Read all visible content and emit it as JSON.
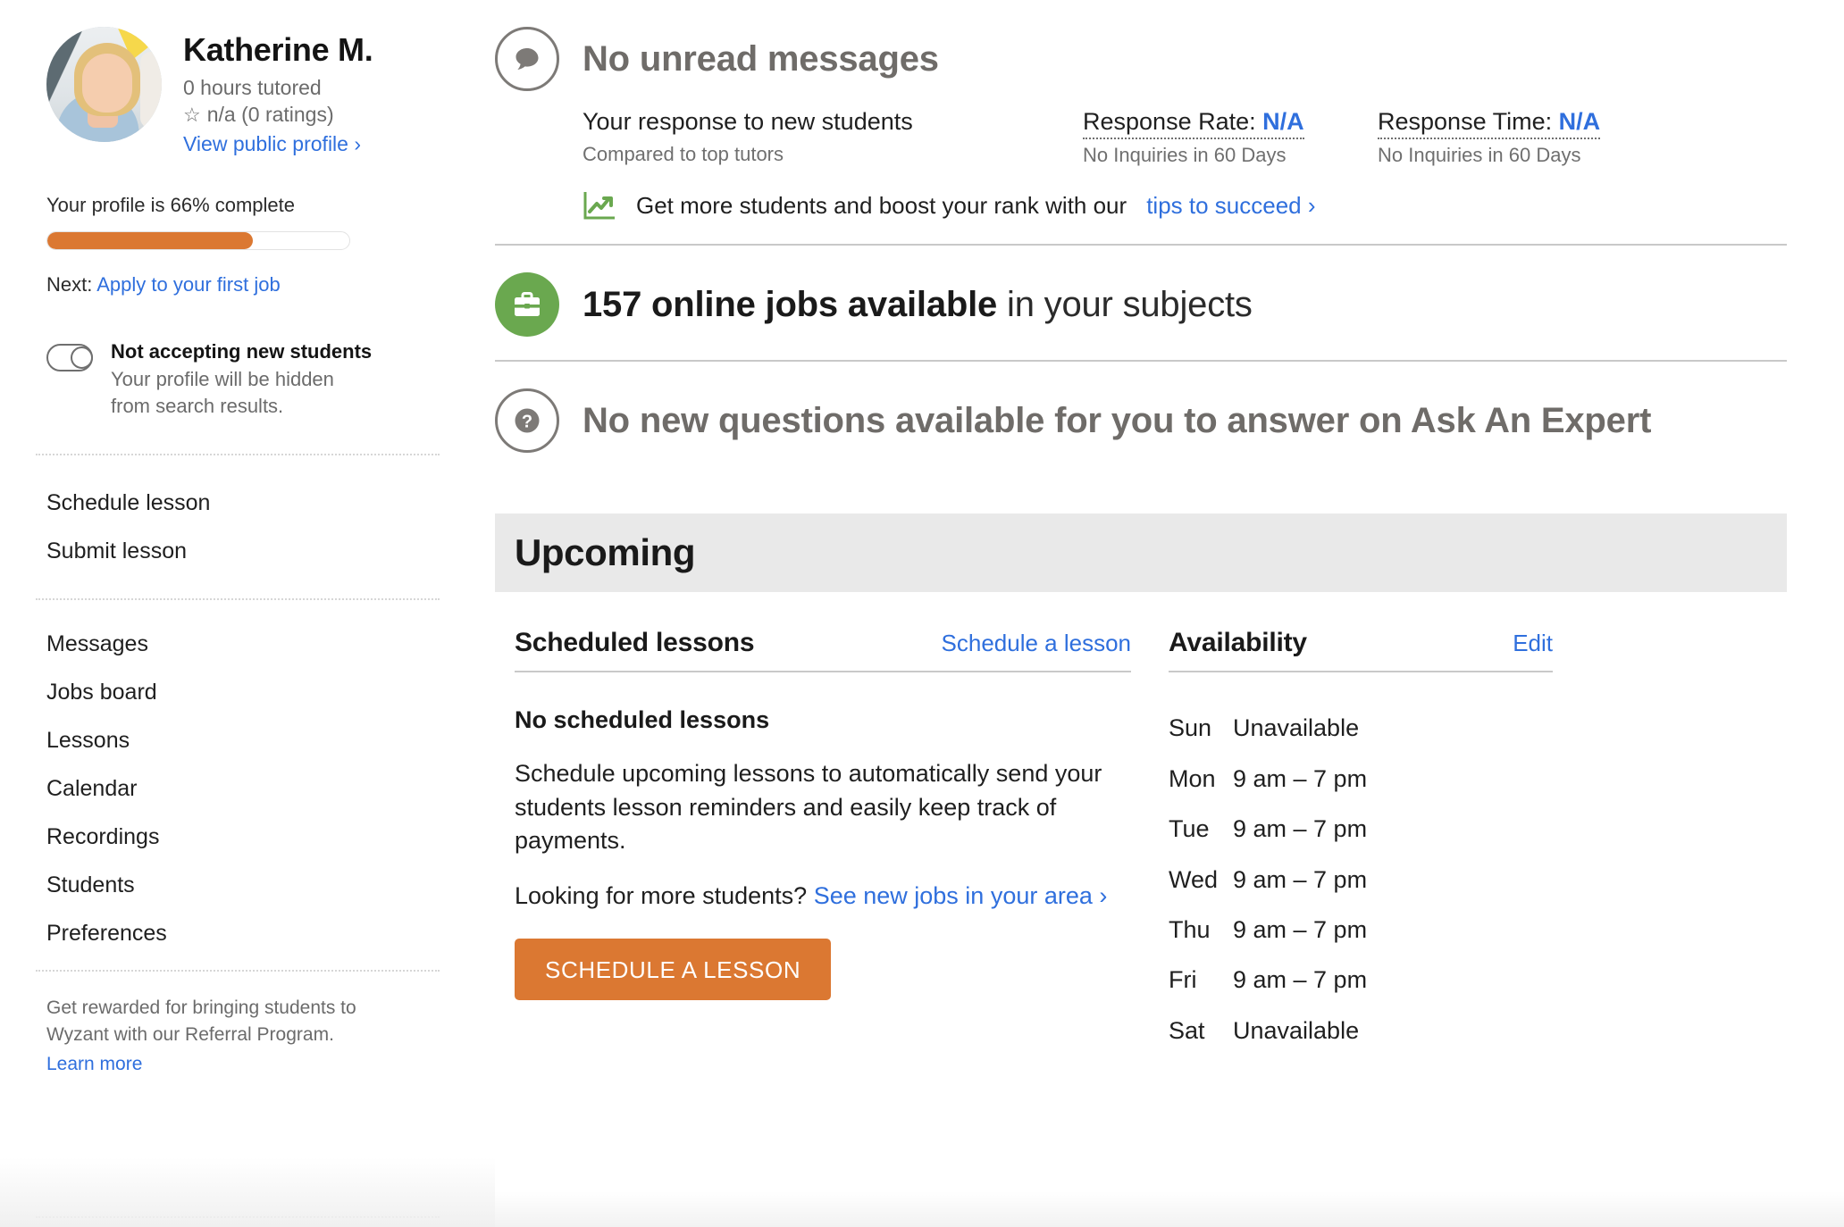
{
  "sidebar": {
    "profile": {
      "name": "Katherine M.",
      "hours": "0 hours tutored",
      "star_icon": "star-outline-icon",
      "rating": "n/a (0 ratings)",
      "view_profile": "View public profile ›",
      "avatar_alt": "avatar"
    },
    "completion": {
      "label": "Your profile is 66% complete",
      "percent": 66,
      "fill_color": "#db7832",
      "next_prefix": "Next: ",
      "next_link": "Apply to your first job"
    },
    "accepting_toggle": {
      "state": "off",
      "title": "Not accepting new students",
      "subtitle": "Your profile will be hidden from search results."
    },
    "nav_group_1": [
      {
        "label": "Schedule lesson",
        "name": "schedule-lesson"
      },
      {
        "label": "Submit lesson",
        "name": "submit-lesson"
      }
    ],
    "nav_group_2": [
      {
        "label": "Messages",
        "name": "messages"
      },
      {
        "label": "Jobs board",
        "name": "jobs-board"
      },
      {
        "label": "Lessons",
        "name": "lessons"
      },
      {
        "label": "Calendar",
        "name": "calendar"
      },
      {
        "label": "Recordings",
        "name": "recordings"
      },
      {
        "label": "Students",
        "name": "students"
      },
      {
        "label": "Preferences",
        "name": "preferences"
      }
    ],
    "referral": {
      "text": "Get rewarded for bringing students to Wyzant with our Referral Program.",
      "link": "Learn more"
    }
  },
  "main": {
    "messages": {
      "icon": "speech-bubble-icon",
      "headline": "No unread messages",
      "response_title": "Your response to new students",
      "response_sub": "Compared to top tutors",
      "stats": [
        {
          "label": "Response Rate:",
          "value": "N/A",
          "sub": "No Inquiries in 60 Days"
        },
        {
          "label": "Response Time:",
          "value": "N/A",
          "sub": "No Inquiries in 60 Days"
        }
      ],
      "tips": {
        "icon": "trending-up-chart-icon",
        "text": "Get more students and boost your rank with our ",
        "link": "tips to succeed ›"
      }
    },
    "jobs": {
      "icon": "briefcase-icon",
      "icon_bg": "#6aa84f",
      "count_text": "157 online jobs available",
      "suffix_text": " in your subjects"
    },
    "expert": {
      "icon": "question-mark-circle-icon",
      "headline": "No new questions available for you to answer on Ask An Expert"
    },
    "upcoming": {
      "title": "Upcoming",
      "lessons": {
        "heading": "Scheduled lessons",
        "action_link": "Schedule a lesson",
        "empty_title": "No scheduled lessons",
        "empty_copy": "Schedule upcoming lessons to automatically send your students lesson reminders and easily keep track of payments.",
        "looking_text": "Looking for more students? ",
        "looking_link": "See new jobs in your area ›",
        "cta_button": "SCHEDULE A LESSON"
      },
      "availability": {
        "heading": "Availability",
        "edit_link": "Edit",
        "rows": [
          {
            "day": "Sun",
            "time": "Unavailable"
          },
          {
            "day": "Mon",
            "time": "9 am – 7 pm"
          },
          {
            "day": "Tue",
            "time": "9 am – 7 pm"
          },
          {
            "day": "Wed",
            "time": "9 am – 7 pm"
          },
          {
            "day": "Thu",
            "time": "9 am – 7 pm"
          },
          {
            "day": "Fri",
            "time": "9 am – 7 pm"
          },
          {
            "day": "Sat",
            "time": "Unavailable"
          }
        ]
      }
    }
  },
  "colors": {
    "accent_orange": "#db7832",
    "link_blue": "#2f6fdd",
    "green": "#6aa84f",
    "muted_gray": "#6f6c69",
    "bar_gray": "#e9e9e9"
  }
}
